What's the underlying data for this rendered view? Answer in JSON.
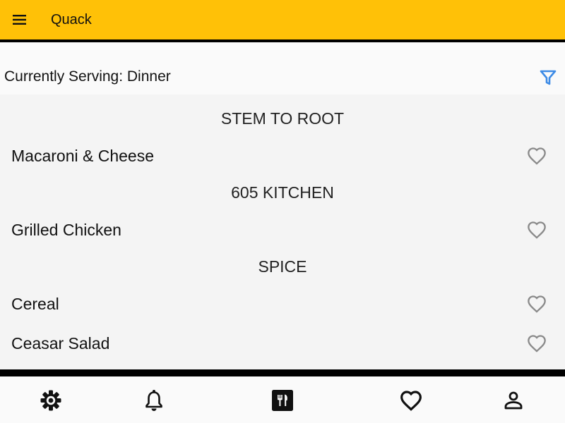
{
  "app_bar": {
    "title": "Quack",
    "menu_icon": "hamburger-menu-icon",
    "background_color": "#ffc107"
  },
  "serving": {
    "text": "Currently Serving: Dinner",
    "filter_icon": "filter-icon",
    "filter_color": "#3d8be6"
  },
  "menu": {
    "sections": [
      {
        "name": "STEM TO ROOT",
        "items": [
          {
            "name": "Macaroni & Cheese",
            "favorite": false
          }
        ]
      },
      {
        "name": "605 KITCHEN",
        "items": [
          {
            "name": "Grilled Chicken",
            "favorite": false
          }
        ]
      },
      {
        "name": "SPICE",
        "items": [
          {
            "name": "Cereal",
            "favorite": false
          },
          {
            "name": "Ceasar Salad",
            "favorite": false
          }
        ]
      }
    ]
  },
  "bottom_nav": {
    "items": [
      {
        "icon": "settings-gear-icon",
        "active": false
      },
      {
        "icon": "notifications-bell-icon",
        "active": false
      },
      {
        "icon": "menu-fork-knife-icon",
        "active": true
      },
      {
        "icon": "favorites-heart-icon",
        "active": false
      },
      {
        "icon": "profile-person-icon",
        "active": false
      }
    ]
  }
}
